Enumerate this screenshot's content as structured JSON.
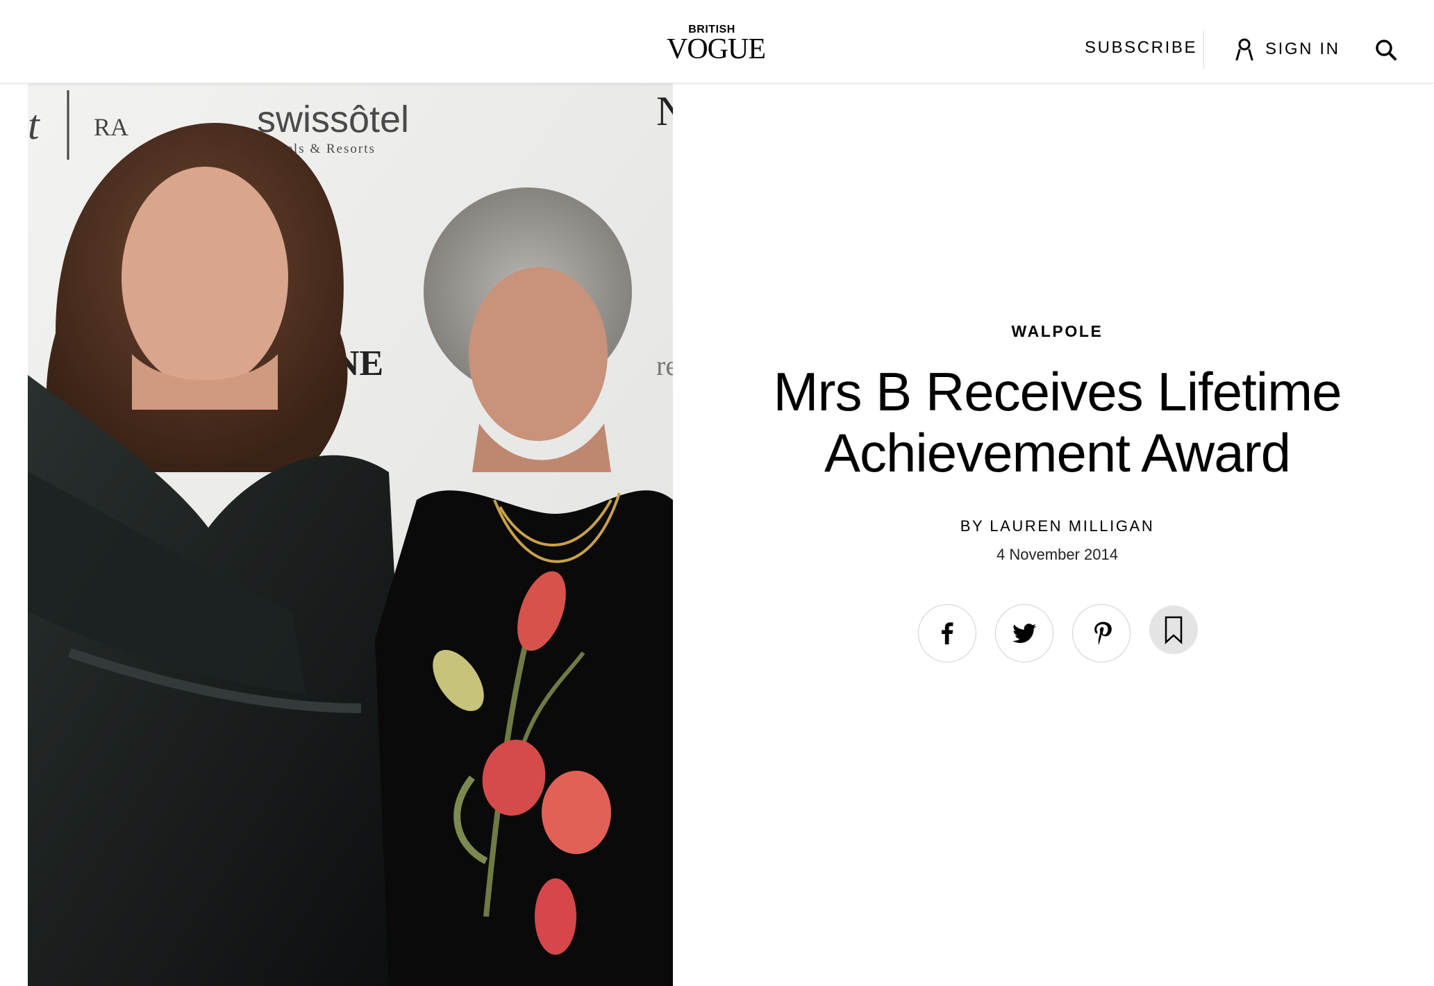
{
  "header": {
    "logo_top": "BRITISH",
    "logo_main": "VOGUE",
    "subscribe_label": "SUBSCRIBE",
    "signin_label": "SIGN IN",
    "icons": {
      "user": "user-icon",
      "search": "search-icon"
    }
  },
  "article": {
    "category": "WALPOLE",
    "title": "Mrs B Receives Lifetime Achievement Award",
    "byline_prefix": "BY",
    "author": "LAUREN MILLIGAN",
    "date": "4 November 2014"
  },
  "share": {
    "icons": [
      "facebook-icon",
      "twitter-icon",
      "pinterest-icon",
      "bookmark-icon"
    ]
  },
  "hero_image": {
    "backdrop_text_1": "swissôtel",
    "backdrop_text_2": "Hotels & Resorts",
    "backdrop_text_3": "NE"
  },
  "colors": {
    "text": "#000000",
    "divider": "#d9d9d9",
    "bookmark_bg": "#e4e4e4"
  }
}
